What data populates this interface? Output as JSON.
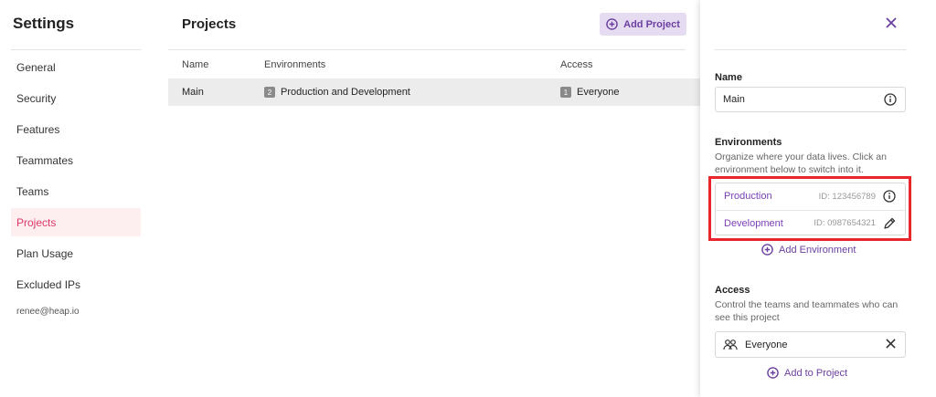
{
  "sidebar": {
    "title": "Settings",
    "items": [
      {
        "label": "General"
      },
      {
        "label": "Security"
      },
      {
        "label": "Features"
      },
      {
        "label": "Teammates"
      },
      {
        "label": "Teams"
      },
      {
        "label": "Projects",
        "active": true
      },
      {
        "label": "Plan Usage"
      },
      {
        "label": "Excluded IPs"
      }
    ],
    "user_email": "renee@heap.io"
  },
  "main": {
    "title": "Projects",
    "add_button_label": "Add Project",
    "table": {
      "columns": [
        "Name",
        "Environments",
        "Access"
      ],
      "rows": [
        {
          "name": "Main",
          "env_count": "2",
          "environments": "Production and Development",
          "access_count": "1",
          "access": "Everyone"
        }
      ]
    }
  },
  "panel": {
    "name_label": "Name",
    "name_value": "Main",
    "environments_label": "Environments",
    "environments_desc": "Organize where your data lives. Click an environment below to switch into it.",
    "environments": [
      {
        "name": "Production",
        "id": "ID: 123456789",
        "icon": "info-icon"
      },
      {
        "name": "Development",
        "id": "ID: 0987654321",
        "icon": "pencil-icon"
      }
    ],
    "add_environment_label": "Add Environment",
    "access_label": "Access",
    "access_desc": "Control the teams and teammates who can see this project",
    "access_value": "Everyone",
    "add_to_project_label": "Add to Project"
  },
  "colors": {
    "accent": "#6b3fa0",
    "active_nav": "#e0386a",
    "highlight": "#e8262b"
  }
}
